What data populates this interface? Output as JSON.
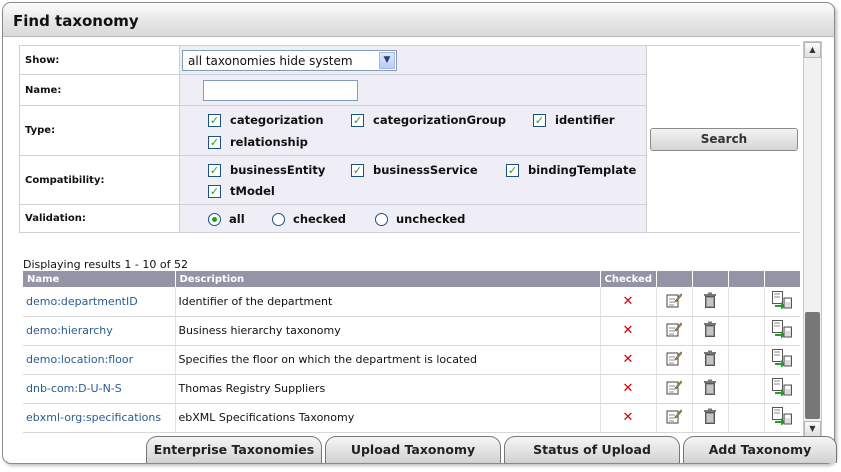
{
  "window": {
    "title": "Find taxonomy"
  },
  "filter": {
    "show": {
      "label": "Show:",
      "selected": "all taxonomies hide system"
    },
    "name": {
      "label": "Name:",
      "value": ""
    },
    "type": {
      "label": "Type:",
      "options": [
        {
          "label": "categorization",
          "checked": true
        },
        {
          "label": "categorizationGroup",
          "checked": true
        },
        {
          "label": "identifier",
          "checked": true
        },
        {
          "label": "relationship",
          "checked": true
        }
      ]
    },
    "compatibility": {
      "label": "Compatibility:",
      "options": [
        {
          "label": "businessEntity",
          "checked": true
        },
        {
          "label": "businessService",
          "checked": true
        },
        {
          "label": "bindingTemplate",
          "checked": true
        },
        {
          "label": "tModel",
          "checked": true
        }
      ]
    },
    "validation": {
      "label": "Validation:",
      "options": [
        {
          "label": "all",
          "selected": true
        },
        {
          "label": "checked",
          "selected": false
        },
        {
          "label": "unchecked",
          "selected": false
        }
      ]
    },
    "search_label": "Search"
  },
  "results": {
    "summary": "Displaying results 1 - 10 of 52",
    "columns": {
      "name": "Name",
      "description": "Description",
      "checked": "Checked"
    },
    "rows": [
      {
        "name": "demo:departmentID",
        "description": "Identifier of the department",
        "checked": "✕"
      },
      {
        "name": "demo:hierarchy",
        "description": "Business hierarchy taxonomy",
        "checked": "✕"
      },
      {
        "name": "demo:location:floor",
        "description": "Specifies the floor on which the department is located",
        "checked": "✕"
      },
      {
        "name": "dnb-com:D-U-N-S",
        "description": "Thomas Registry Suppliers",
        "checked": "✕"
      },
      {
        "name": "ebxml-org:specifications",
        "description": "ebXML Specifications Taxonomy",
        "checked": "✕"
      }
    ]
  },
  "tabs": [
    {
      "label": "Enterprise Taxonomies"
    },
    {
      "label": "Upload Taxonomy"
    },
    {
      "label": "Status of Upload"
    },
    {
      "label": "Add Taxonomy"
    }
  ],
  "colors": {
    "header_bg": "#9494a6",
    "form_bg": "#efedf6",
    "link": "#2a5b93",
    "check_green": "#21a121",
    "x_red": "#d40000"
  }
}
